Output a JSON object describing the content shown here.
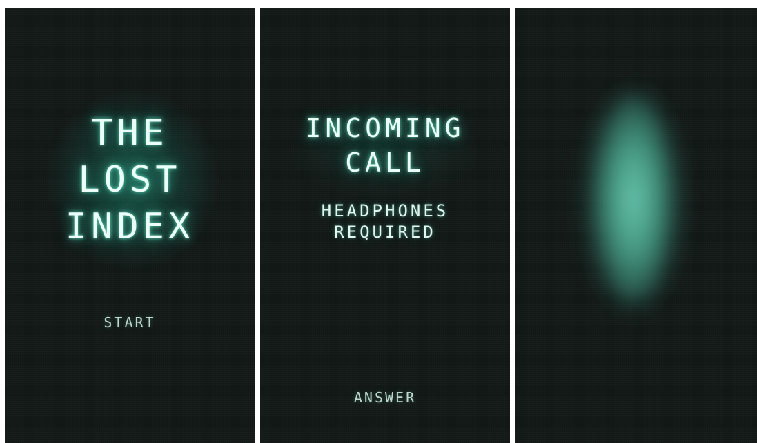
{
  "screens": {
    "title_screen": {
      "title_lines": [
        "THE",
        "LOST",
        "INDEX"
      ],
      "start_label": "START"
    },
    "call_screen": {
      "title_lines": [
        "INCOMING",
        "CALL"
      ],
      "subtitle_lines": [
        "HEADPHONES",
        "REQUIRED"
      ],
      "answer_label": "ANSWER"
    },
    "speaker_screen": {
      "visual": "glowing-orb"
    }
  },
  "colors": {
    "background": "#121816",
    "glow": "#3ca08a",
    "text": "#eafff8",
    "orb": "#6ecdb4"
  }
}
